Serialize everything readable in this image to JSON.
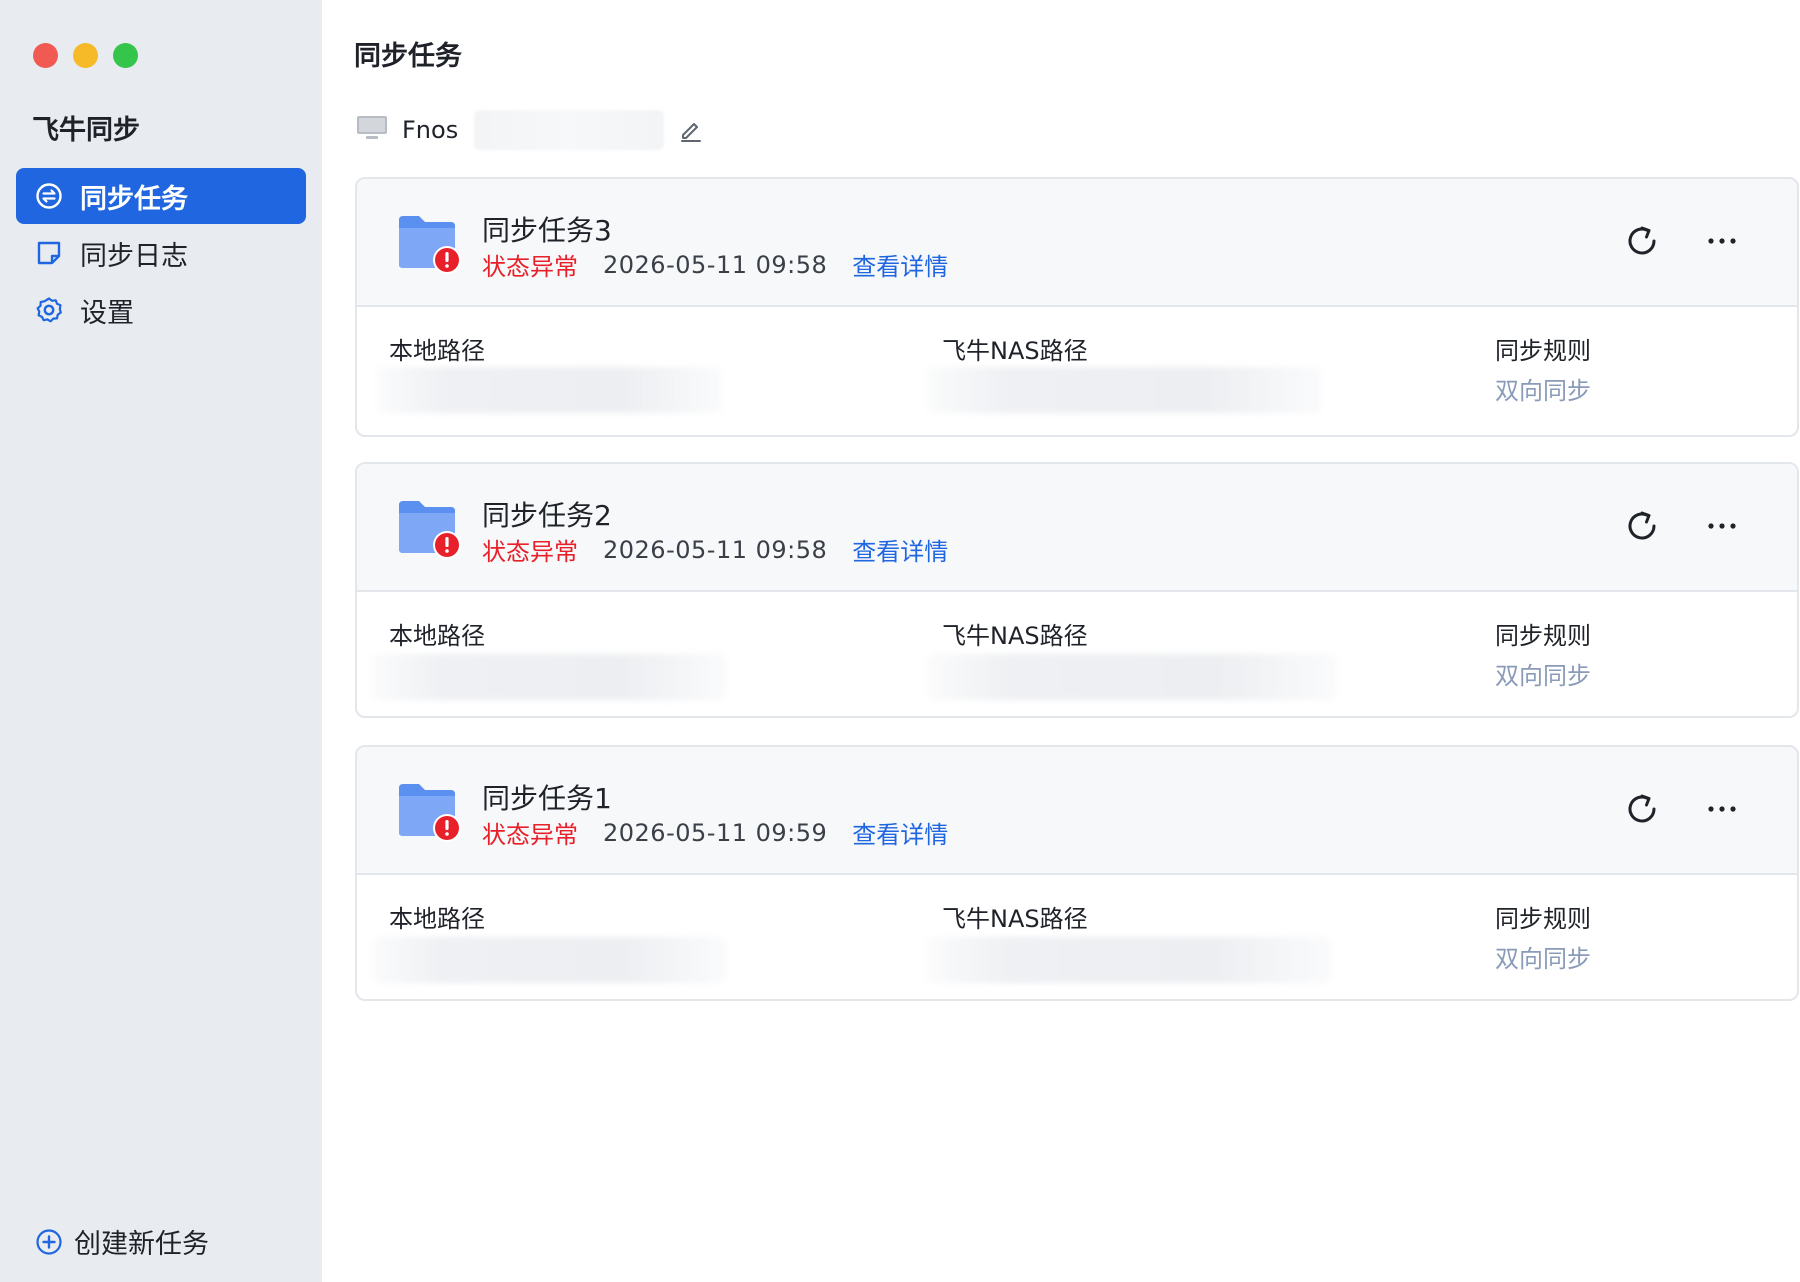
{
  "app": {
    "title": "飞牛同步"
  },
  "sidebar": {
    "items": [
      {
        "label": "同步任务",
        "icon": "sync-task-icon",
        "active": true
      },
      {
        "label": "同步日志",
        "icon": "log-icon",
        "active": false
      },
      {
        "label": "设置",
        "icon": "gear-icon",
        "active": false
      }
    ],
    "create_label": "创建新任务"
  },
  "main": {
    "title": "同步任务",
    "device": {
      "name": "Fnos"
    },
    "tasks": [
      {
        "name": "同步任务3",
        "status": "状态异常",
        "time": "2026-05-11 09:58",
        "detail_link": "查看详情",
        "local_path_label": "本地路径",
        "nas_path_label": "飞牛NAS路径",
        "rule_label": "同步规则",
        "rule_value": "双向同步"
      },
      {
        "name": "同步任务2",
        "status": "状态异常",
        "time": "2026-05-11 09:58",
        "detail_link": "查看详情",
        "local_path_label": "本地路径",
        "nas_path_label": "飞牛NAS路径",
        "rule_label": "同步规则",
        "rule_value": "双向同步"
      },
      {
        "name": "同步任务1",
        "status": "状态异常",
        "time": "2026-05-11 09:59",
        "detail_link": "查看详情",
        "local_path_label": "本地路径",
        "nas_path_label": "飞牛NAS路径",
        "rule_label": "同步规则",
        "rule_value": "双向同步"
      }
    ]
  },
  "colors": {
    "accent": "#1f66e0",
    "error": "#e8202a",
    "sidebar_bg": "#e8ebf0",
    "folder": "#5b8ff0"
  }
}
